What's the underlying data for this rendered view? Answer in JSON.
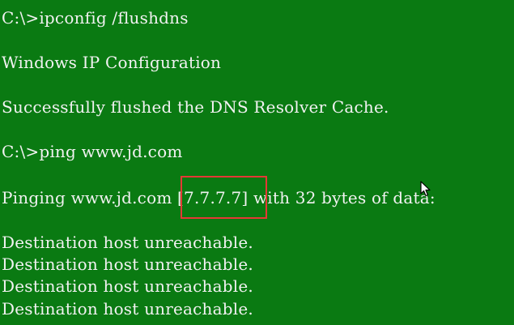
{
  "console": {
    "lines": {
      "cmd_flushdns": "C:\\>ipconfig /flushdns",
      "ip_config_header": "Windows IP Configuration",
      "flush_success": "Successfully flushed the DNS Resolver Cache.",
      "cmd_ping": "C:\\>ping www.jd.com"
    },
    "ping": {
      "prefix": "Pinging www.jd.com [",
      "ip": "7.7.7.7",
      "suffix": "] with 32 bytes of data:"
    },
    "replies": [
      "Destination host unreachable.",
      "Destination host unreachable.",
      "Destination host unreachable.",
      "Destination host unreachable."
    ]
  },
  "colors": {
    "background": "#0a7a12",
    "text": "#f2f2f2",
    "highlight_border": "#e53935"
  },
  "icons": {
    "cursor": "mouse-pointer-icon"
  }
}
